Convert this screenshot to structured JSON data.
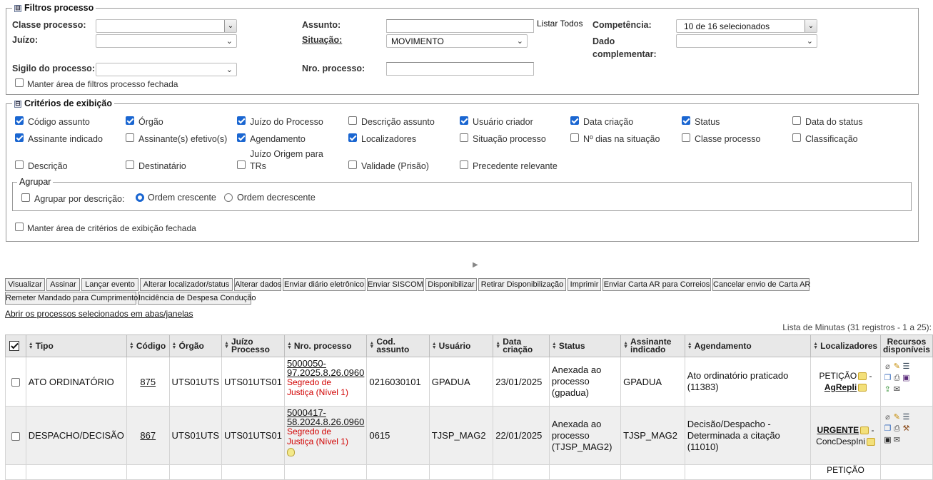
{
  "filtros": {
    "legend": "Filtros processo",
    "toggle": "⊟",
    "classe_label": "Classe processo:",
    "juizo_label": "Juízo:",
    "sigilo_label": "Sigilo do processo:",
    "assunto_label": "Assunto:",
    "listar_todos": "Listar Todos",
    "situacao_label": "Situação:",
    "situacao_value": "MOVIMENTO",
    "nro_label": "Nro. processo:",
    "competencia_label": "Competência:",
    "competencia_value": "10 de 16 selecionados",
    "dado_label_1": "Dado",
    "dado_label_2": "complementar:",
    "manter": "Manter área de filtros processo fechada"
  },
  "criterios": {
    "legend": "Critérios de exibição",
    "toggle": "⊟",
    "items": [
      {
        "label": "Código assunto",
        "checked": true
      },
      {
        "label": "Órgão",
        "checked": true
      },
      {
        "label": "Juízo do Processo",
        "checked": true
      },
      {
        "label": "Descrição assunto",
        "checked": false
      },
      {
        "label": "Usuário criador",
        "checked": true
      },
      {
        "label": "Data criação",
        "checked": true
      },
      {
        "label": "Status",
        "checked": true
      },
      {
        "label": "Data do status",
        "checked": false
      },
      {
        "label": "Assinante indicado",
        "checked": true
      },
      {
        "label": "Assinante(s) efetivo(s)",
        "checked": false
      },
      {
        "label": "Agendamento",
        "checked": true
      },
      {
        "label": "Localizadores",
        "checked": true
      },
      {
        "label": "Situação processo",
        "checked": false
      },
      {
        "label": "Nº dias na situação",
        "checked": false
      },
      {
        "label": "Classe processo",
        "checked": false
      },
      {
        "label": "Classificação",
        "checked": false
      },
      {
        "label": "Descrição",
        "checked": false
      },
      {
        "label": "Destinatário",
        "checked": false
      },
      {
        "label": "Juízo Origem para",
        "label2": "TRs",
        "checked": false
      },
      {
        "label": "Validade (Prisão)",
        "checked": false
      },
      {
        "label": "Precedente relevante",
        "checked": false
      }
    ],
    "agrupar_legend": "Agrupar",
    "agrupar_label": "Agrupar por descrição:",
    "ordem_cres": "Ordem crescente",
    "ordem_decres": "Ordem decrescente",
    "manter": "Manter área de critérios de exibição fechada"
  },
  "expand_arrow": "▶",
  "toolbar": {
    "row1": [
      "Visualizar",
      "Assinar",
      "Lançar evento",
      "Alterar localizador/status",
      "Alterar dados",
      "Enviar diário eletrônico",
      "Enviar SISCOM",
      "Disponibilizar",
      "Retirar Disponibilização",
      "Imprimir",
      "Enviar Carta AR para Correios",
      "Cancelar envio de Carta AR"
    ],
    "row2": [
      "Remeter Mandado para Cumprimento",
      "Incidência de Despesa Condução"
    ]
  },
  "abrir_link": "Abrir os processos selecionados em abas/janelas",
  "lista_info": "Lista de Minutas (31 registros - 1 a 25):",
  "table": {
    "headers": {
      "tipo": "Tipo",
      "codigo": "Código",
      "orgao": "Órgão",
      "juizo1": "Juízo",
      "juizo2": "Processo",
      "nro": "Nro. processo",
      "cod1": "Cod.",
      "cod2": "assunto",
      "usuario": "Usuário",
      "data1": "Data",
      "data2": "criação",
      "status": "Status",
      "assin1": "Assinante",
      "assin2": "indicado",
      "agend": "Agendamento",
      "local": "Localizadores",
      "rec1": "Recursos",
      "rec2": "disponíveis"
    },
    "rows": [
      {
        "tipo": "ATO ORDINATÓRIO",
        "codigo": "875",
        "orgao": "UTS01UTS",
        "juizo": "UTS01UTS01",
        "nro1": "5000050-",
        "nro2": "97.2025.8.26.0960",
        "seg1": "Segredo de",
        "seg2": "Justiça (Nível 1)",
        "cod_assunto": "0216030101",
        "usuario": "GPADUA",
        "data": "23/01/2025",
        "status1": "Anexada ao",
        "status2": "processo",
        "status3": "(gpadua)",
        "assinante": "GPADUA",
        "agend1": "Ato ordinatório praticado",
        "agend2": "(11383)",
        "loc1": "PETIÇÃO",
        "loc_sep": " -",
        "loc2": "AgRepli"
      },
      {
        "tipo": "DESPACHO/DECISÃO",
        "codigo": "867",
        "orgao": "UTS01UTS",
        "juizo": "UTS01UTS01",
        "nro1": "5000417-",
        "nro2": "58.2024.8.26.0960",
        "seg1": "Segredo de",
        "seg2": "Justiça (Nível 1)",
        "cod_assunto": "0615",
        "usuario": "TJSP_MAG2",
        "data": "22/01/2025",
        "status1": "Anexada ao",
        "status2": "processo",
        "status3": "(TJSP_MAG2)",
        "assinante": "TJSP_MAG2",
        "agend1": "Decisão/Despacho -",
        "agend2": "Determinada a citação",
        "agend3": "(11010)",
        "loc1": "URGENTE",
        "loc_sep": " -",
        "loc2": "ConcDespIni"
      },
      {
        "loc1": "PETIÇÃO"
      }
    ]
  }
}
